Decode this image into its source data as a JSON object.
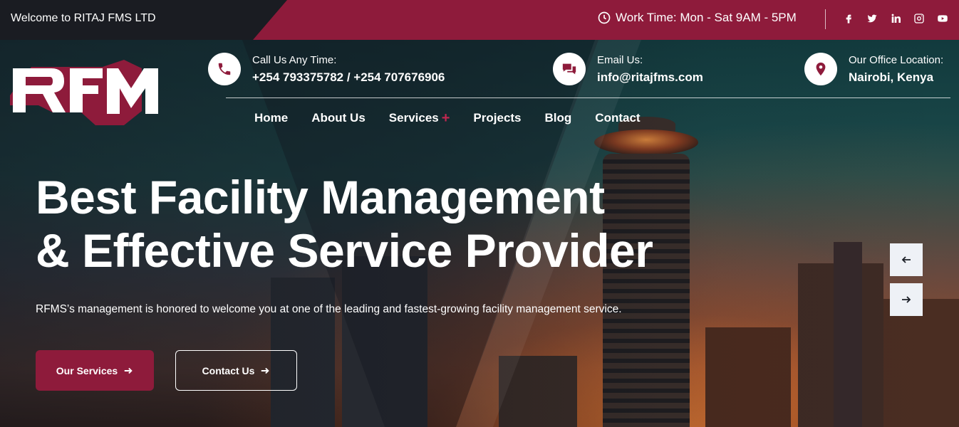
{
  "topbar": {
    "welcome": "Welcome to RITAJ FMS LTD",
    "work_time": "Work Time: Mon - Sat 9AM - 5PM",
    "socials": [
      "facebook-icon",
      "twitter-icon",
      "linkedin-icon",
      "instagram-icon",
      "youtube-icon"
    ]
  },
  "brand": {
    "logo_text": "RFM",
    "accent": "#8e1b3b"
  },
  "contact": {
    "phone": {
      "label": "Call Us Any Time:",
      "value": "+254 793375782 / +254 707676906"
    },
    "email": {
      "label": "Email Us:",
      "value": "info@ritajfms.com"
    },
    "office": {
      "label": "Our Office Location:",
      "value": "Nairobi, Kenya"
    }
  },
  "nav": {
    "items": [
      {
        "label": "Home"
      },
      {
        "label": "About Us"
      },
      {
        "label": "Services",
        "suffix": "+"
      },
      {
        "label": "Projects"
      },
      {
        "label": "Blog"
      },
      {
        "label": "Contact"
      }
    ]
  },
  "hero": {
    "headline_line1": "Best Facility Management",
    "headline_line2": "& Effective Service Provider",
    "subtext": "RFMS’s management is honored to welcome you at one of the leading and fastest-growing facility management service.",
    "primary_button": "Our Services",
    "secondary_button": "Contact Us"
  }
}
